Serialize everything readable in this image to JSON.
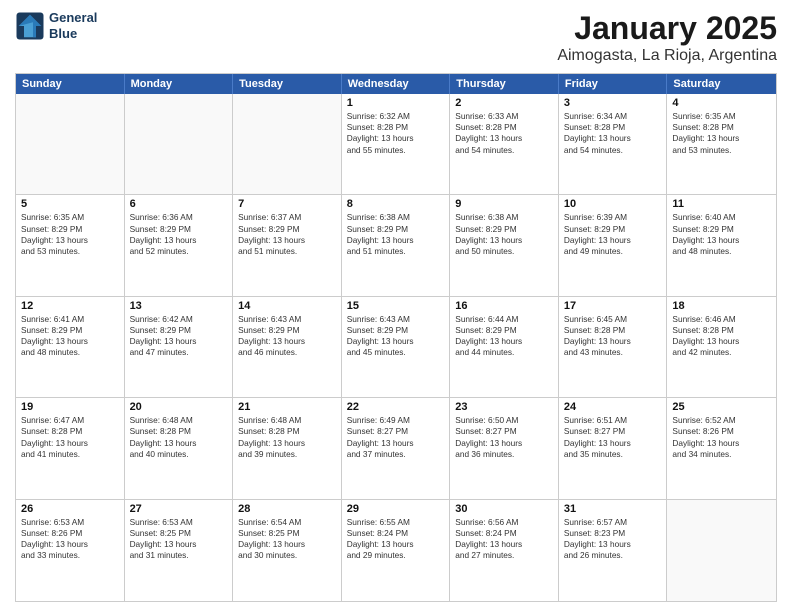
{
  "header": {
    "logo_line1": "General",
    "logo_line2": "Blue",
    "title": "January 2025",
    "subtitle": "Aimogasta, La Rioja, Argentina"
  },
  "calendar": {
    "days_of_week": [
      "Sunday",
      "Monday",
      "Tuesday",
      "Wednesday",
      "Thursday",
      "Friday",
      "Saturday"
    ],
    "rows": [
      [
        {
          "day": "",
          "lines": [],
          "empty": true
        },
        {
          "day": "",
          "lines": [],
          "empty": true
        },
        {
          "day": "",
          "lines": [],
          "empty": true
        },
        {
          "day": "1",
          "lines": [
            "Sunrise: 6:32 AM",
            "Sunset: 8:28 PM",
            "Daylight: 13 hours",
            "and 55 minutes."
          ],
          "empty": false
        },
        {
          "day": "2",
          "lines": [
            "Sunrise: 6:33 AM",
            "Sunset: 8:28 PM",
            "Daylight: 13 hours",
            "and 54 minutes."
          ],
          "empty": false
        },
        {
          "day": "3",
          "lines": [
            "Sunrise: 6:34 AM",
            "Sunset: 8:28 PM",
            "Daylight: 13 hours",
            "and 54 minutes."
          ],
          "empty": false
        },
        {
          "day": "4",
          "lines": [
            "Sunrise: 6:35 AM",
            "Sunset: 8:28 PM",
            "Daylight: 13 hours",
            "and 53 minutes."
          ],
          "empty": false
        }
      ],
      [
        {
          "day": "5",
          "lines": [
            "Sunrise: 6:35 AM",
            "Sunset: 8:29 PM",
            "Daylight: 13 hours",
            "and 53 minutes."
          ],
          "empty": false
        },
        {
          "day": "6",
          "lines": [
            "Sunrise: 6:36 AM",
            "Sunset: 8:29 PM",
            "Daylight: 13 hours",
            "and 52 minutes."
          ],
          "empty": false
        },
        {
          "day": "7",
          "lines": [
            "Sunrise: 6:37 AM",
            "Sunset: 8:29 PM",
            "Daylight: 13 hours",
            "and 51 minutes."
          ],
          "empty": false
        },
        {
          "day": "8",
          "lines": [
            "Sunrise: 6:38 AM",
            "Sunset: 8:29 PM",
            "Daylight: 13 hours",
            "and 51 minutes."
          ],
          "empty": false
        },
        {
          "day": "9",
          "lines": [
            "Sunrise: 6:38 AM",
            "Sunset: 8:29 PM",
            "Daylight: 13 hours",
            "and 50 minutes."
          ],
          "empty": false
        },
        {
          "day": "10",
          "lines": [
            "Sunrise: 6:39 AM",
            "Sunset: 8:29 PM",
            "Daylight: 13 hours",
            "and 49 minutes."
          ],
          "empty": false
        },
        {
          "day": "11",
          "lines": [
            "Sunrise: 6:40 AM",
            "Sunset: 8:29 PM",
            "Daylight: 13 hours",
            "and 48 minutes."
          ],
          "empty": false
        }
      ],
      [
        {
          "day": "12",
          "lines": [
            "Sunrise: 6:41 AM",
            "Sunset: 8:29 PM",
            "Daylight: 13 hours",
            "and 48 minutes."
          ],
          "empty": false
        },
        {
          "day": "13",
          "lines": [
            "Sunrise: 6:42 AM",
            "Sunset: 8:29 PM",
            "Daylight: 13 hours",
            "and 47 minutes."
          ],
          "empty": false
        },
        {
          "day": "14",
          "lines": [
            "Sunrise: 6:43 AM",
            "Sunset: 8:29 PM",
            "Daylight: 13 hours",
            "and 46 minutes."
          ],
          "empty": false
        },
        {
          "day": "15",
          "lines": [
            "Sunrise: 6:43 AM",
            "Sunset: 8:29 PM",
            "Daylight: 13 hours",
            "and 45 minutes."
          ],
          "empty": false
        },
        {
          "day": "16",
          "lines": [
            "Sunrise: 6:44 AM",
            "Sunset: 8:29 PM",
            "Daylight: 13 hours",
            "and 44 minutes."
          ],
          "empty": false
        },
        {
          "day": "17",
          "lines": [
            "Sunrise: 6:45 AM",
            "Sunset: 8:28 PM",
            "Daylight: 13 hours",
            "and 43 minutes."
          ],
          "empty": false
        },
        {
          "day": "18",
          "lines": [
            "Sunrise: 6:46 AM",
            "Sunset: 8:28 PM",
            "Daylight: 13 hours",
            "and 42 minutes."
          ],
          "empty": false
        }
      ],
      [
        {
          "day": "19",
          "lines": [
            "Sunrise: 6:47 AM",
            "Sunset: 8:28 PM",
            "Daylight: 13 hours",
            "and 41 minutes."
          ],
          "empty": false
        },
        {
          "day": "20",
          "lines": [
            "Sunrise: 6:48 AM",
            "Sunset: 8:28 PM",
            "Daylight: 13 hours",
            "and 40 minutes."
          ],
          "empty": false
        },
        {
          "day": "21",
          "lines": [
            "Sunrise: 6:48 AM",
            "Sunset: 8:28 PM",
            "Daylight: 13 hours",
            "and 39 minutes."
          ],
          "empty": false
        },
        {
          "day": "22",
          "lines": [
            "Sunrise: 6:49 AM",
            "Sunset: 8:27 PM",
            "Daylight: 13 hours",
            "and 37 minutes."
          ],
          "empty": false
        },
        {
          "day": "23",
          "lines": [
            "Sunrise: 6:50 AM",
            "Sunset: 8:27 PM",
            "Daylight: 13 hours",
            "and 36 minutes."
          ],
          "empty": false
        },
        {
          "day": "24",
          "lines": [
            "Sunrise: 6:51 AM",
            "Sunset: 8:27 PM",
            "Daylight: 13 hours",
            "and 35 minutes."
          ],
          "empty": false
        },
        {
          "day": "25",
          "lines": [
            "Sunrise: 6:52 AM",
            "Sunset: 8:26 PM",
            "Daylight: 13 hours",
            "and 34 minutes."
          ],
          "empty": false
        }
      ],
      [
        {
          "day": "26",
          "lines": [
            "Sunrise: 6:53 AM",
            "Sunset: 8:26 PM",
            "Daylight: 13 hours",
            "and 33 minutes."
          ],
          "empty": false
        },
        {
          "day": "27",
          "lines": [
            "Sunrise: 6:53 AM",
            "Sunset: 8:25 PM",
            "Daylight: 13 hours",
            "and 31 minutes."
          ],
          "empty": false
        },
        {
          "day": "28",
          "lines": [
            "Sunrise: 6:54 AM",
            "Sunset: 8:25 PM",
            "Daylight: 13 hours",
            "and 30 minutes."
          ],
          "empty": false
        },
        {
          "day": "29",
          "lines": [
            "Sunrise: 6:55 AM",
            "Sunset: 8:24 PM",
            "Daylight: 13 hours",
            "and 29 minutes."
          ],
          "empty": false
        },
        {
          "day": "30",
          "lines": [
            "Sunrise: 6:56 AM",
            "Sunset: 8:24 PM",
            "Daylight: 13 hours",
            "and 27 minutes."
          ],
          "empty": false
        },
        {
          "day": "31",
          "lines": [
            "Sunrise: 6:57 AM",
            "Sunset: 8:23 PM",
            "Daylight: 13 hours",
            "and 26 minutes."
          ],
          "empty": false
        },
        {
          "day": "",
          "lines": [],
          "empty": true
        }
      ]
    ]
  }
}
